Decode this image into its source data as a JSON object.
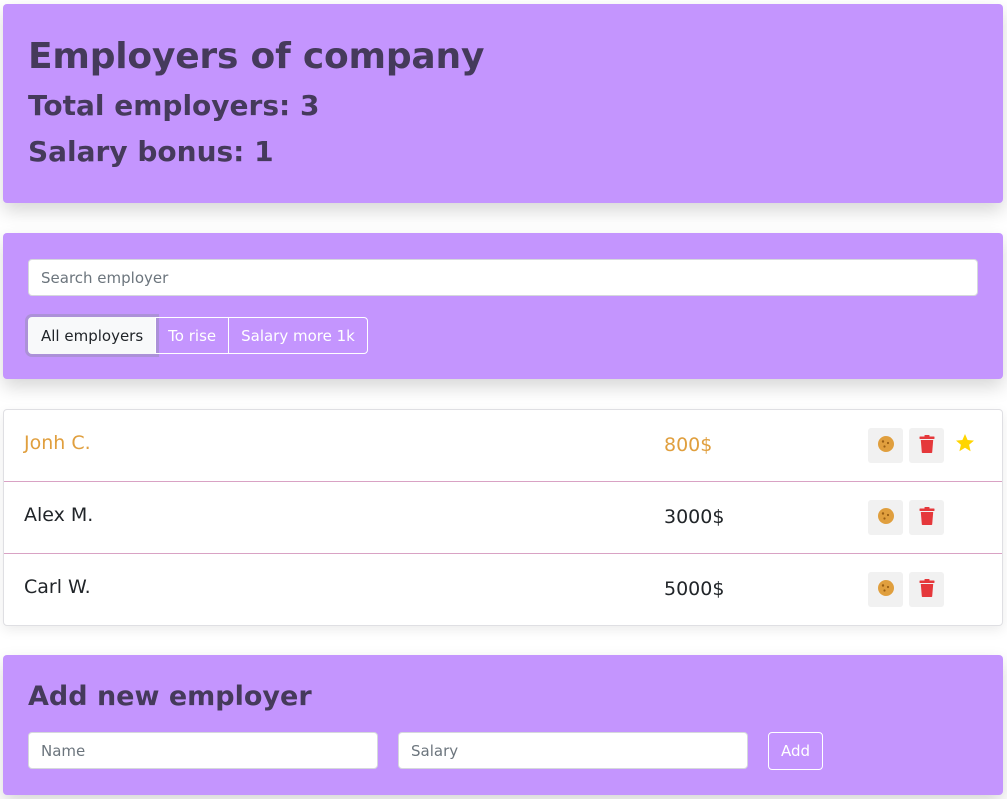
{
  "app_info": {
    "title": "Employers of company",
    "total_label": "Total employers: 3",
    "bonus_label": "Salary bonus: 1"
  },
  "search": {
    "placeholder": "Search employer",
    "value": ""
  },
  "filters": [
    {
      "label": "All employers",
      "active": true
    },
    {
      "label": "To rise",
      "active": false
    },
    {
      "label": "Salary more 1k",
      "active": false
    }
  ],
  "employees": [
    {
      "name": "Jonh C.",
      "salary": "800$",
      "increase": true,
      "rise": true
    },
    {
      "name": "Alex M.",
      "salary": "3000$",
      "increase": false,
      "rise": false
    },
    {
      "name": "Carl W.",
      "salary": "5000$",
      "increase": false,
      "rise": false
    }
  ],
  "add_form": {
    "title": "Add new employer",
    "name_placeholder": "Name",
    "salary_placeholder": "Salary",
    "submit_label": "Add"
  },
  "icons": {
    "increase": "cookie-icon",
    "delete": "trash-icon",
    "rise": "star-icon"
  },
  "colors": {
    "panel_bg": "#c495fe",
    "heading": "#453a5b",
    "increase_text": "#e09f3e",
    "cookie": "#e09f3e",
    "trash": "#e5383b",
    "star": "#ffd500",
    "row_divider": "#d9a2c4"
  }
}
